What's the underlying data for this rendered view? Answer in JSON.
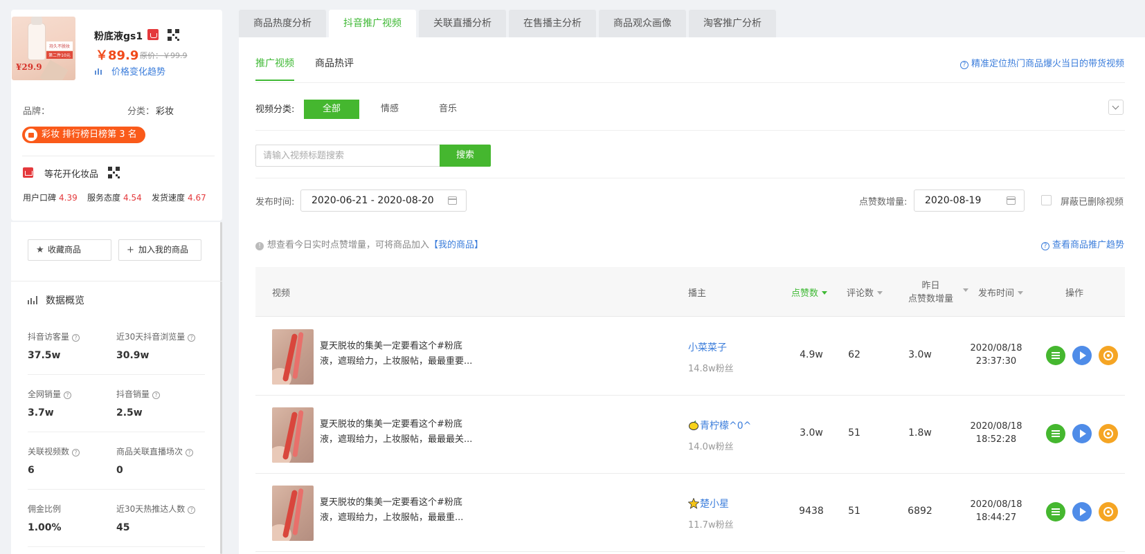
{
  "product": {
    "name": "粉底液gs1",
    "thumb_badge_top": "持久不脱妆",
    "thumb_badge_bottom": "第二件10元",
    "thumb_price": "29.9",
    "price": "￥89.9",
    "original_price": "原价：￥99.9",
    "trend_link": "价格变化趋势",
    "brand_label": "品牌：",
    "category_label": "分类：",
    "category_value": "彩妆",
    "rank_badge": "彩妆 排行榜日榜第 3 名"
  },
  "store": {
    "name": "等花开化妆品",
    "scores": [
      {
        "label": "用户口碑",
        "value": "4.39"
      },
      {
        "label": "服务态度",
        "value": "4.54"
      },
      {
        "label": "发货速度",
        "value": "4.67"
      }
    ]
  },
  "actions": {
    "favorite": "收藏商品",
    "add_mine": "加入我的商品"
  },
  "overview": {
    "title": "数据概览",
    "stats": [
      {
        "label": "抖音访客量",
        "value": "37.5w"
      },
      {
        "label": "近30天抖音浏览量",
        "value": "30.9w"
      },
      {
        "label": "全网销量",
        "value": "3.7w"
      },
      {
        "label": "抖音销量",
        "value": "2.5w"
      },
      {
        "label": "关联视频数",
        "value": "6"
      },
      {
        "label": "商品关联直播场次",
        "value": "0"
      },
      {
        "label": "佣金比例",
        "value": "1.00%"
      },
      {
        "label": "近30天热推达人数",
        "value": "45"
      }
    ]
  },
  "tabs": [
    "商品热度分析",
    "抖音推广视频",
    "关联直播分析",
    "在售播主分析",
    "商品观众画像",
    "淘客推广分析"
  ],
  "subtabs": [
    "推广视频",
    "商品热评"
  ],
  "top_right_link": "精准定位热门商品爆火当日的带货视频",
  "filter": {
    "label": "视频分类:",
    "chips": [
      "全部",
      "情感",
      "音乐"
    ]
  },
  "search": {
    "placeholder": "请输入视频标题搜索",
    "button": "搜索"
  },
  "dates": {
    "publish_label": "发布时间:",
    "publish_range": "2020-06-21 - 2020-08-20",
    "likes_label": "点赞数增量:",
    "likes_date": "2020-08-19",
    "hide_deleted": "屏蔽已删除视频"
  },
  "tip": {
    "text": "想查看今日实时点赞增量，可将商品加入",
    "link": "【我的商品】",
    "right_link": "查看商品推广趋势"
  },
  "table": {
    "headers": {
      "video": "视频",
      "anchor": "播主",
      "likes": "点赞数",
      "comments": "评论数",
      "inc_line1": "昨日",
      "inc_line2": "点赞数增量",
      "time": "发布时间",
      "ops": "操作"
    },
    "rows": [
      {
        "title1": "夏天脱妆的集美一定要看这个#粉底",
        "title2": "液，遮瑕给力，上妆服帖，最最重要...",
        "anchor": "小菜菜子",
        "emoji": "",
        "fans": "14.8w粉丝",
        "likes": "4.9w",
        "comments": "62",
        "inc": "3.0w",
        "date": "2020/08/18",
        "time": "23:37:30"
      },
      {
        "title1": "夏天脱妆的集美一定要看这个#粉底",
        "title2": "液，遮瑕给力，上妆服帖，最最最关...",
        "anchor": "青柠檬^0^",
        "emoji": "lemon-emoji",
        "fans": "14.0w粉丝",
        "likes": "3.0w",
        "comments": "51",
        "inc": "1.8w",
        "date": "2020/08/18",
        "time": "18:52:28"
      },
      {
        "title1": "夏天脱妆的集美一定要看这个#粉底",
        "title2": "液，遮瑕给力，上妆服帖，最最重...",
        "anchor": "楚小星",
        "emoji": "star-emoji",
        "fans": "11.7w粉丝",
        "likes": "9438",
        "comments": "51",
        "inc": "6892",
        "date": "2020/08/18",
        "time": "18:44:27"
      }
    ]
  },
  "colors": {
    "accent_green": "#45b72f",
    "link_blue": "#3b7ddb",
    "price_orange": "#f04a1b",
    "rank_orange": "#fa5a1a"
  }
}
